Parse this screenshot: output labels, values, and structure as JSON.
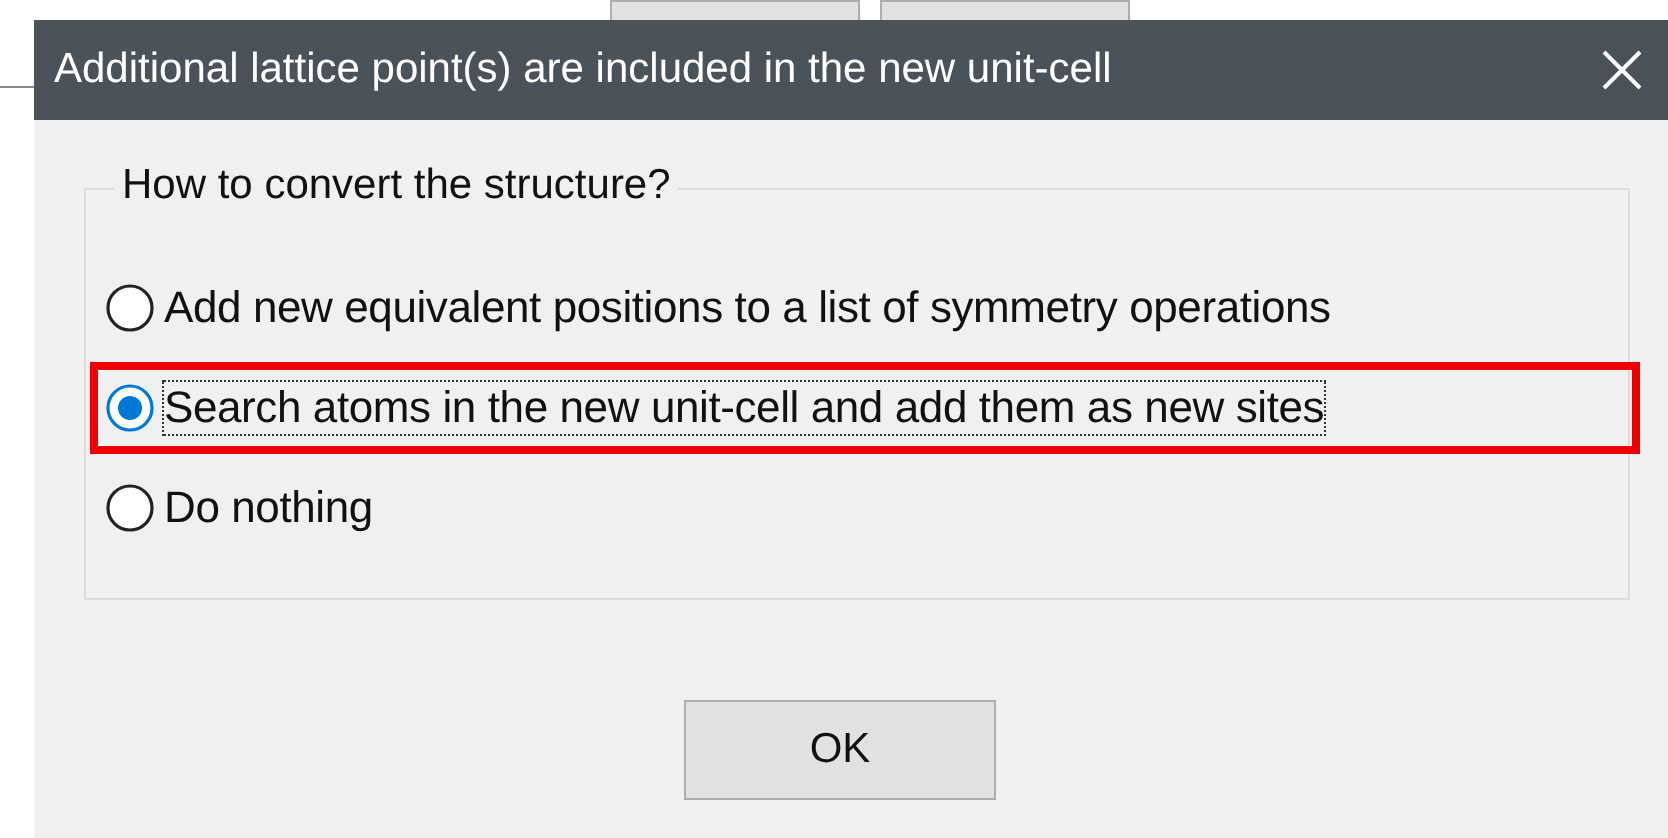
{
  "window": {
    "title": "Additional lattice point(s) are included in the new unit-cell"
  },
  "group": {
    "legend": "How to convert the structure?"
  },
  "options": [
    {
      "label": "Add new equivalent positions to a list of symmetry operations",
      "selected": false,
      "highlighted": false
    },
    {
      "label": "Search atoms in the new unit-cell and add them as new sites",
      "selected": true,
      "highlighted": true
    },
    {
      "label": "Do nothing",
      "selected": false,
      "highlighted": false
    }
  ],
  "buttons": [
    "OK"
  ]
}
